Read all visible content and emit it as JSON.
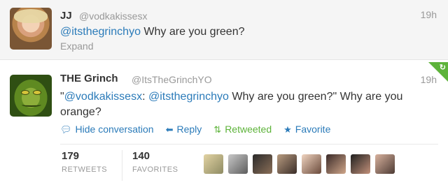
{
  "tweet_1": {
    "name": "JJ",
    "handle": "@vodkakissesx",
    "time": "19h",
    "mention": "@itsthegrinchyo",
    "text": " Why are you green?",
    "expand_label": "Expand"
  },
  "tweet_2": {
    "name": "THE Grinch",
    "handle": "@ItsTheGrinchYO",
    "time": "19h",
    "text_quote_open": "\"",
    "mention_1": "@vodkakissesx",
    "text_sep": ": ",
    "mention_2": "@itsthegrinchyo",
    "text_rest": " Why are you green?\" Why are you orange?",
    "actions": {
      "hide_conversation": "Hide conversation",
      "reply": "Reply",
      "retweeted": "Retweeted",
      "favorite": "Favorite"
    },
    "stats": {
      "retweets_count": "179",
      "retweets_label": "RETWEETS",
      "favorites_count": "140",
      "favorites_label": "FAVORITES"
    },
    "favoriter_avatar_count": 8
  },
  "colors": {
    "link": "#2b7bb9",
    "retweet_green": "#5db33a",
    "muted": "#999999",
    "text": "#333333",
    "highlight_bg": "#f5f5f5"
  },
  "icons": {
    "hide_conversation": "speech-bubble-icon",
    "reply": "reply-arrow-icon",
    "retweeted": "retweet-icon",
    "favorite": "star-icon",
    "corner": "retweet-corner-icon"
  }
}
